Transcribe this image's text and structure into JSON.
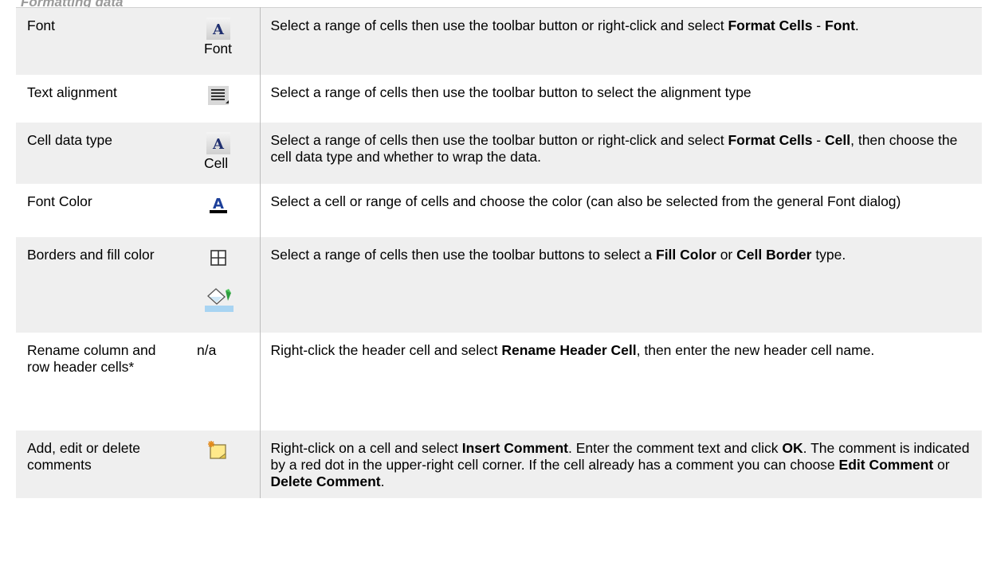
{
  "section_heading": "Formatting data",
  "rows": [
    {
      "feature": "Font",
      "icon_names": [
        "font-icon"
      ],
      "icon_caption": "Font",
      "description": [
        {
          "t": "Select a range of cells then use the toolbar button or right-click and select "
        },
        {
          "t": "Format Cells",
          "b": true
        },
        {
          "t": " - "
        },
        {
          "t": "Font",
          "b": true
        },
        {
          "t": "."
        }
      ]
    },
    {
      "feature": "Text alignment",
      "icon_names": [
        "text-align-icon"
      ],
      "description": [
        {
          "t": "Select a range of cells then use the toolbar button to select the alignment type"
        }
      ]
    },
    {
      "feature": "Cell data type",
      "icon_names": [
        "cell-format-icon"
      ],
      "icon_caption": "Cell",
      "description": [
        {
          "t": "Select a range of cells then use the toolbar button or right-click and select "
        },
        {
          "t": "Format Cells",
          "b": true
        },
        {
          "t": " - "
        },
        {
          "t": "Cell",
          "b": true
        },
        {
          "t": ", then choose the cell data type and whether to wrap the data."
        }
      ]
    },
    {
      "feature": "Font Color",
      "icon_names": [
        "font-color-icon"
      ],
      "description": [
        {
          "t": "Select a cell or range of cells and choose the color (can also be selected from the general Font dialog)"
        }
      ]
    },
    {
      "feature": "Borders and fill color",
      "icon_names": [
        "cell-border-icon",
        "fill-color-icon"
      ],
      "description": [
        {
          "t": "Select a range of cells then use the toolbar buttons to select a "
        },
        {
          "t": "Fill Color",
          "b": true
        },
        {
          "t": " or "
        },
        {
          "t": "Cell Border",
          "b": true
        },
        {
          "t": " type."
        }
      ]
    },
    {
      "feature": "Rename column and row header cells*",
      "icon_names": [],
      "icon_text": "n/a",
      "description": [
        {
          "t": "Right-click the header cell and select "
        },
        {
          "t": "Rename Header Cell",
          "b": true
        },
        {
          "t": ", then enter the new header cell name."
        }
      ]
    },
    {
      "feature": "Add, edit or delete comments",
      "icon_names": [
        "insert-comment-icon"
      ],
      "description": [
        {
          "t": "Right-click on a cell and select "
        },
        {
          "t": "Insert Comment",
          "b": true
        },
        {
          "t": ". Enter the comment text and click "
        },
        {
          "t": "OK",
          "b": true
        },
        {
          "t": ". The comment is indicated by a red dot in the upper-right cell corner. If the cell already has a comment you can choose "
        },
        {
          "t": "Edit Comment",
          "b": true
        },
        {
          "t": " or "
        },
        {
          "t": "Delete Comment",
          "b": true
        },
        {
          "t": "."
        }
      ]
    }
  ]
}
